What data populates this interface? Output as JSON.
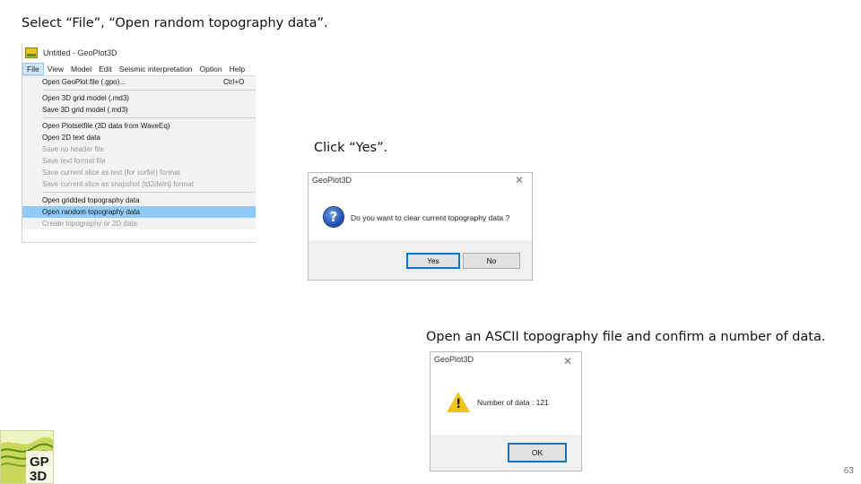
{
  "captions": {
    "step1": "Select “File”, “Open random topography data”.",
    "step2": "Click “Yes”.",
    "step3": "Open an ASCII topography file and confirm a number of data."
  },
  "window": {
    "title": "Untitled - GeoPlot3D",
    "menubar": [
      "File",
      "View",
      "Model",
      "Edit",
      "Seismic interpretation",
      "Option",
      "Help"
    ]
  },
  "file_menu": {
    "groups": [
      [
        {
          "label": "Open GeoPlot file (.gpo)...",
          "shortcut": "Ctrl+O"
        }
      ],
      [
        {
          "label": "Open 3D grid model (.md3)"
        },
        {
          "label": "Save 3D grid model (.md3)"
        }
      ],
      [
        {
          "label": "Open Plotsetfile (3D data from WaveEq)"
        },
        {
          "label": "Open 2D text data"
        },
        {
          "label": "Save no header file",
          "disabled": true
        },
        {
          "label": "Save text format file",
          "disabled": true
        },
        {
          "label": "Save current slice as text (for surfer) format",
          "disabled": true
        },
        {
          "label": "Save current slice as snapshot (td2dwin) format",
          "disabled": true
        }
      ],
      [
        {
          "label": "Open gridded topography data"
        },
        {
          "label": "Open random topography data",
          "highlighted": true
        },
        {
          "label": "Create topography or 2D data",
          "disabled": true
        }
      ]
    ]
  },
  "dialog_confirm": {
    "title": "GeoPlot3D",
    "message": "Do you want to clear current topography data ?",
    "yes_label": "Yes",
    "no_label": "No",
    "close_glyph": "✕",
    "icon": "question-icon"
  },
  "dialog_info": {
    "title": "GeoPlot3D",
    "message": "Number of data : 121",
    "ok_label": "OK",
    "close_glyph": "✕",
    "icon": "warning-icon"
  },
  "logo": {
    "line1": "GP",
    "line2": "3D"
  },
  "page_number": "63"
}
